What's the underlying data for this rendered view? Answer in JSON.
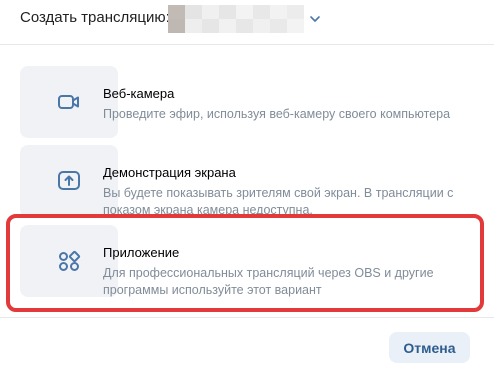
{
  "header": {
    "label": "Создать трансляцию:",
    "owner_icon": "chevron-down-icon"
  },
  "options": [
    {
      "icon": "video-camera-icon",
      "title": "Веб-камера",
      "description": "Проведите эфир, используя веб-камеру своего компьютера"
    },
    {
      "icon": "screen-share-icon",
      "title": "Демонстрация экрана",
      "description": "Вы будете показывать зрителям свой экран. В трансляции с показом экрана камера недоступна."
    },
    {
      "icon": "apps-icon",
      "title": "Приложение",
      "description": "Для профессиональных трансляций через OBS и другие программы используйте этот вариант",
      "highlighted": true
    }
  ],
  "footer": {
    "cancel_label": "Отмена"
  },
  "colors": {
    "accent": "#2d5c8f",
    "icon": "#4a76a8",
    "highlight": "#e23a3a",
    "secondary_text": "#818c99"
  }
}
